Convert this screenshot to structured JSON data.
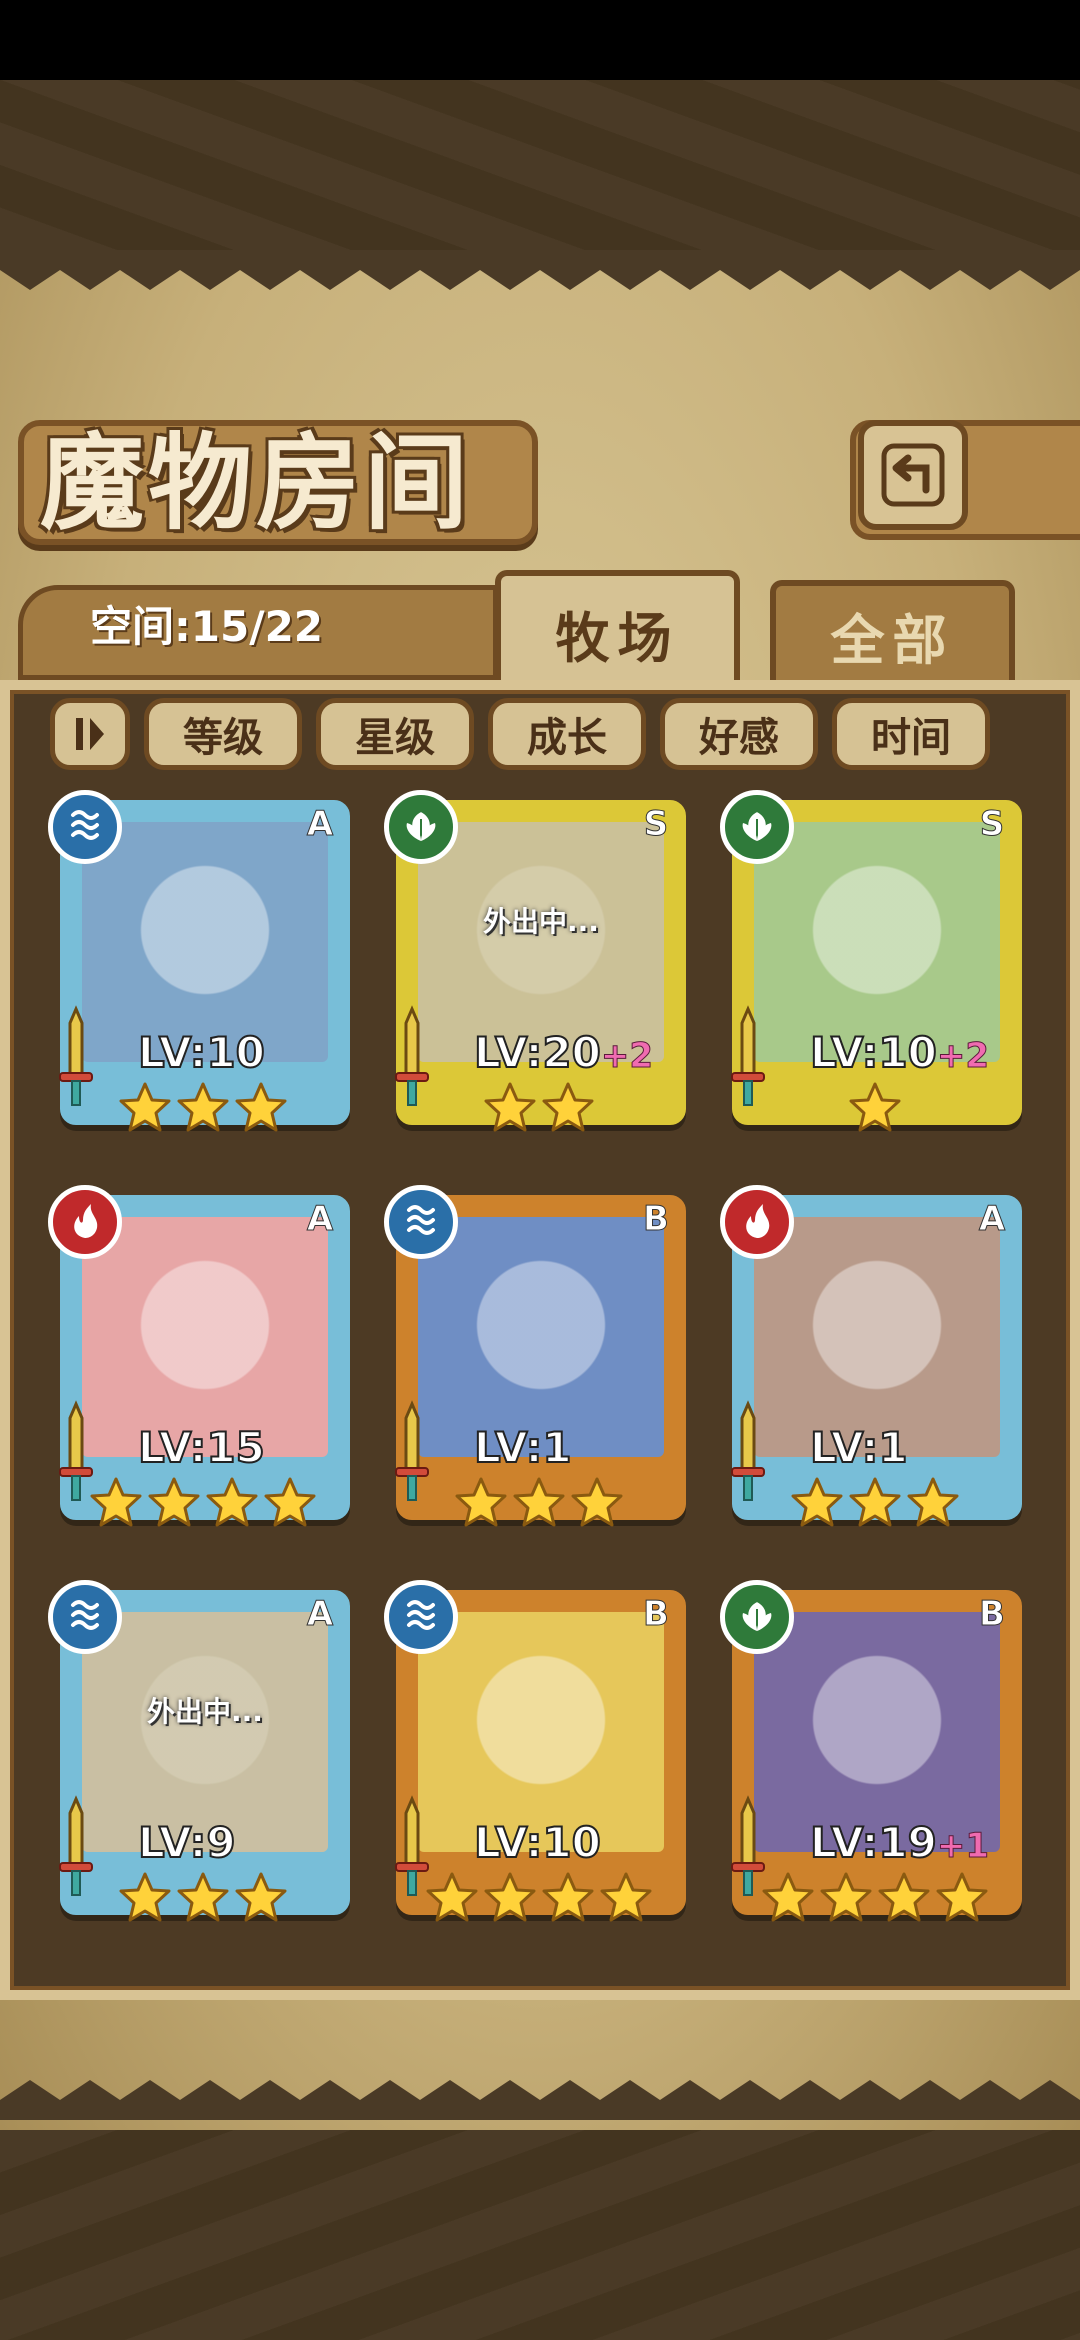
{
  "title": "魔物房间",
  "space": "空间:15/22",
  "tabs": {
    "ranch": "牧场",
    "all": "全部"
  },
  "sort_buttons": [
    "等级",
    "星级",
    "成长",
    "好感",
    "时间"
  ],
  "colors": {
    "frame_A": "#7ec8e3",
    "frame_S": "#e8d23a",
    "frame_B": "#d8892e",
    "element_water": "#2a6fa8",
    "element_grass": "#2f7a3a",
    "element_fire": "#c0292b"
  },
  "cards": [
    {
      "rank": "A",
      "element": "water",
      "level": "LV:10",
      "bonus": "",
      "stars": 3,
      "status": "",
      "portrait": "#7fa6c9"
    },
    {
      "rank": "S",
      "element": "grass",
      "level": "LV:20",
      "bonus": "+2",
      "stars": 2,
      "status": "外出中...",
      "portrait": "#cfc69a"
    },
    {
      "rank": "S",
      "element": "grass",
      "level": "LV:10",
      "bonus": "+2",
      "stars": 1,
      "status": "",
      "portrait": "#a8c98a"
    },
    {
      "rank": "A",
      "element": "fire",
      "level": "LV:15",
      "bonus": "",
      "stars": 4,
      "status": "",
      "portrait": "#e7a6a6"
    },
    {
      "rank": "B",
      "element": "water",
      "level": "LV:1",
      "bonus": "",
      "stars": 3,
      "status": "",
      "portrait": "#6f8ec4"
    },
    {
      "rank": "A",
      "element": "fire",
      "level": "LV:1",
      "bonus": "",
      "stars": 3,
      "status": "",
      "portrait": "#b89a8a"
    },
    {
      "rank": "A",
      "element": "water",
      "level": "LV:9",
      "bonus": "",
      "stars": 3,
      "status": "外出中...",
      "portrait": "#c9c2b4"
    },
    {
      "rank": "B",
      "element": "water",
      "level": "LV:10",
      "bonus": "",
      "stars": 4,
      "status": "",
      "portrait": "#e6c75a"
    },
    {
      "rank": "B",
      "element": "grass",
      "level": "LV:19",
      "bonus": "+1",
      "stars": 4,
      "status": "",
      "portrait": "#7a6aa0"
    }
  ]
}
